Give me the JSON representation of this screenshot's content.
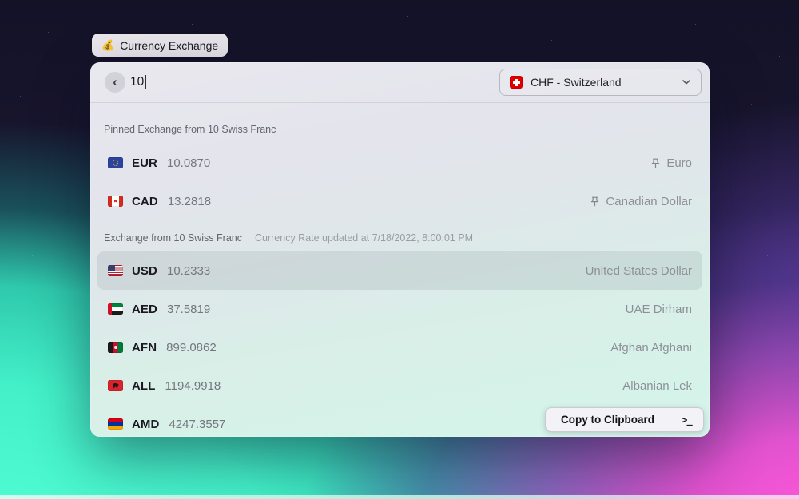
{
  "pill": {
    "emoji": "💰",
    "label": "Currency Exchange"
  },
  "header": {
    "back_glyph": "‹",
    "input_value": "10",
    "currency_select": {
      "flag": "ch",
      "label": "CHF - Switzerland"
    }
  },
  "pinned_section": {
    "title": "Pinned Exchange from 10 Swiss Franc",
    "rows": [
      {
        "flag": "eu",
        "code": "EUR",
        "value": "10.0870",
        "name": "Euro",
        "pinned": true
      },
      {
        "flag": "ca",
        "code": "CAD",
        "value": "13.2818",
        "name": "Canadian Dollar",
        "pinned": true
      }
    ]
  },
  "exchange_section": {
    "title": "Exchange from 10 Swiss Franc",
    "subtitle": "Currency Rate updated at 7/18/2022, 8:00:01 PM",
    "rows": [
      {
        "flag": "us",
        "code": "USD",
        "value": "10.2333",
        "name": "United States Dollar",
        "selected": true
      },
      {
        "flag": "ae",
        "code": "AED",
        "value": "37.5819",
        "name": "UAE Dirham"
      },
      {
        "flag": "af",
        "code": "AFN",
        "value": "899.0862",
        "name": "Afghan Afghani"
      },
      {
        "flag": "al",
        "code": "ALL",
        "value": "1194.9918",
        "name": "Albanian Lek"
      },
      {
        "flag": "am",
        "code": "AMD",
        "value": "4247.3557",
        "name": ""
      }
    ]
  },
  "actions": {
    "copy_label": "Copy to Clipboard",
    "terminal_glyph": ">_"
  },
  "colors": {
    "bg_navy": "#1b1834",
    "bg_teal": "#43f0c8",
    "bg_magenta": "#e152cf",
    "selection_tint": "rgba(116,132,134,0.16)",
    "swiss_red": "#e00000"
  }
}
